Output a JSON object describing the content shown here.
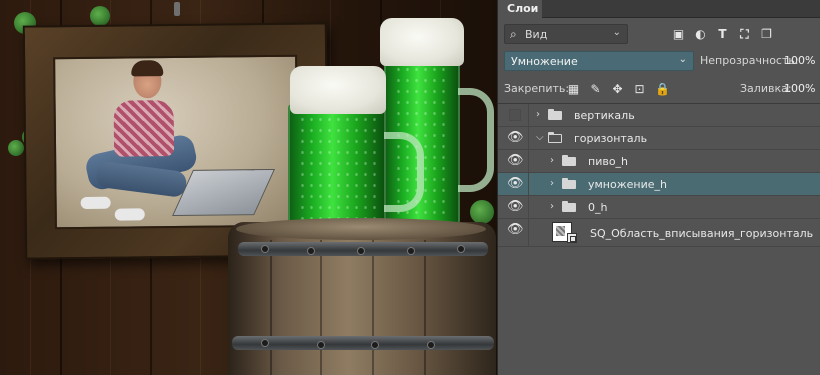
{
  "panel": {
    "tab_label": "Слои",
    "filter": {
      "kind_label": "Вид",
      "search_icon": "search-icon",
      "icons": [
        "image-filter-icon",
        "adjustment-filter-icon",
        "type-filter-icon",
        "shape-filter-icon",
        "smart-object-filter-icon"
      ]
    },
    "blend_mode": "Умножение",
    "opacity_label": "Непрозрачность:",
    "opacity_value": "100%",
    "lock_label": "Закрепить:",
    "lock_icons": [
      "lock-transparent-icon",
      "lock-image-icon",
      "lock-position-icon",
      "lock-artboard-icon",
      "lock-all-icon"
    ],
    "fill_label": "Заливка:",
    "fill_value": "100%"
  },
  "layers": [
    {
      "name": "вертикаль",
      "type": "group",
      "visible": false,
      "expanded": false,
      "indent": 0,
      "selected": false
    },
    {
      "name": "горизонталь",
      "type": "group",
      "visible": true,
      "expanded": true,
      "indent": 0,
      "selected": false
    },
    {
      "name": "пиво_h",
      "type": "group",
      "visible": true,
      "expanded": false,
      "indent": 1,
      "selected": false
    },
    {
      "name": "умножение_h",
      "type": "group",
      "visible": true,
      "expanded": false,
      "indent": 1,
      "selected": true
    },
    {
      "name": "0_h",
      "type": "group",
      "visible": true,
      "expanded": false,
      "indent": 1,
      "selected": false
    },
    {
      "name": "SQ_Область_вписывания_горизонталь",
      "type": "smart-object",
      "visible": true,
      "indent": 0,
      "selected": false
    }
  ],
  "colors": {
    "panel_bg": "#535353",
    "selected_row": "#4b6b73",
    "blend_select": "#4a6b75",
    "beer_green": "#1bae22"
  }
}
